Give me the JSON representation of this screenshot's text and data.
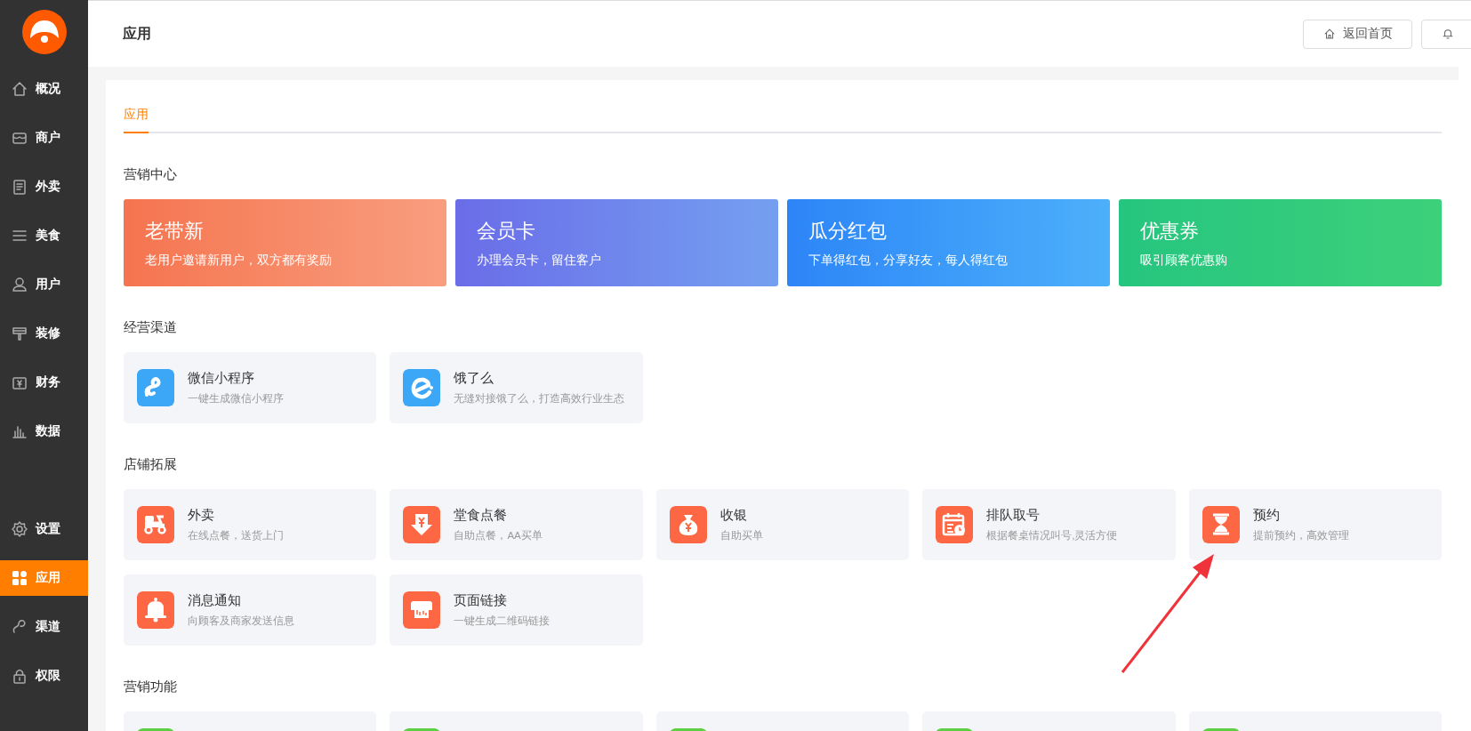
{
  "sidebar": {
    "top_items": [
      {
        "label": "概况",
        "selected": false
      },
      {
        "label": "商户",
        "selected": false
      },
      {
        "label": "外卖",
        "selected": false
      },
      {
        "label": "美食",
        "selected": false
      },
      {
        "label": "用户",
        "selected": false
      },
      {
        "label": "装修",
        "selected": false
      },
      {
        "label": "财务",
        "selected": false
      },
      {
        "label": "数据",
        "selected": false
      }
    ],
    "bottom_items": [
      {
        "label": "设置",
        "selected": false
      },
      {
        "label": "应用",
        "selected": true
      },
      {
        "label": "渠道",
        "selected": false
      },
      {
        "label": "权限",
        "selected": false
      }
    ]
  },
  "header": {
    "title": "应用",
    "home_button": "返回首页"
  },
  "tabs": [
    {
      "label": "应用",
      "selected": true
    }
  ],
  "sections": [
    {
      "title": "营销中心",
      "kind": "promo",
      "items": [
        {
          "title": "老带新",
          "subtitle": "老用户邀请新用户，双方都有奖励",
          "color": "#f5744f"
        },
        {
          "title": "会员卡",
          "subtitle": "办理会员卡，留住客户",
          "color": "#6a6ce8"
        },
        {
          "title": "瓜分红包",
          "subtitle": "下单得红包，分享好友，每人得红包",
          "color": "#2d85f7"
        },
        {
          "title": "优惠券",
          "subtitle": "吸引顾客优惠购",
          "color": "#25c57f"
        }
      ]
    },
    {
      "title": "经营渠道",
      "kind": "apps",
      "items": [
        {
          "title": "微信小程序",
          "subtitle": "一键生成微信小程序",
          "color": "#3ca6f7"
        },
        {
          "title": "饿了么",
          "subtitle": "无缝对接饿了么，打造高效行业生态",
          "color": "#3ca6f7"
        }
      ]
    },
    {
      "title": "店铺拓展",
      "kind": "apps",
      "items": [
        {
          "title": "外卖",
          "subtitle": "在线点餐，送货上门",
          "color": "#fe6743"
        },
        {
          "title": "堂食点餐",
          "subtitle": "自助点餐，AA买单",
          "color": "#fe6743"
        },
        {
          "title": "收银",
          "subtitle": "自助买单",
          "color": "#fe6743"
        },
        {
          "title": "排队取号",
          "subtitle": "根据餐桌情况叫号,灵活方便",
          "color": "#fe6743"
        },
        {
          "title": "预约",
          "subtitle": "提前预约，高效管理",
          "color": "#fe6743"
        },
        {
          "title": "消息通知",
          "subtitle": "向顾客及商家发送信息",
          "color": "#fe6743"
        },
        {
          "title": "页面链接",
          "subtitle": "一键生成二维码链接",
          "color": "#fe6743"
        }
      ]
    },
    {
      "title": "营销功能",
      "kind": "apps",
      "items": [
        {
          "color": "#5ccf45"
        },
        {
          "color": "#5ccf45"
        },
        {
          "color": "#5ccf45"
        },
        {
          "color": "#5ccf45"
        },
        {
          "color": "#5ccf45"
        }
      ]
    }
  ]
}
